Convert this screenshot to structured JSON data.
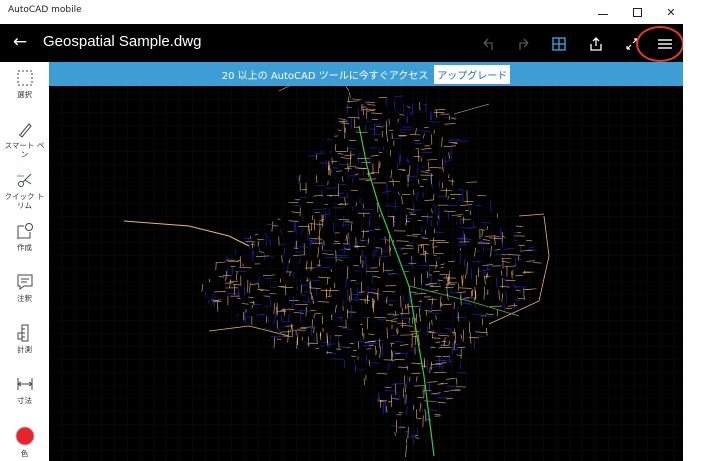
{
  "window": {
    "title": "AutoCAD mobile",
    "minimize_glyph": "–",
    "close_glyph": "✕"
  },
  "toolbar": {
    "back_glyph": "←",
    "document_title": "Geospatial Sample.dwg",
    "icons": [
      "undo-icon",
      "redo-icon",
      "grid-view-icon",
      "share-icon",
      "fullscreen-icon",
      "hamburger-menu-icon"
    ]
  },
  "banner": {
    "text": "20 以上の AutoCAD ツールに今すぐアクセス",
    "upgrade_label": "アップグレード"
  },
  "tools": [
    {
      "label": "選択",
      "icon": "select-icon"
    },
    {
      "label": "スマート ペン",
      "icon": "smart-pen-icon"
    },
    {
      "label": "クイック トリム",
      "icon": "quick-trim-icon"
    },
    {
      "label": "作成",
      "icon": "create-icon"
    },
    {
      "label": "注釈",
      "icon": "annotate-icon"
    },
    {
      "label": "計測",
      "icon": "measure-icon"
    },
    {
      "label": "寸法",
      "icon": "dimension-icon"
    },
    {
      "label": "色",
      "icon": "color-icon"
    }
  ],
  "colors": {
    "toolbar_bg": "#000000",
    "banner_bg": "#3d9ed6",
    "canvas_bg": "#000000",
    "drawing_orange": "#f0b27a",
    "drawing_blue": "#1f2bd6",
    "drawing_green": "#38c94a",
    "highlight_ring": "#e23b2a",
    "color_tool_dot": "#e8232b"
  }
}
